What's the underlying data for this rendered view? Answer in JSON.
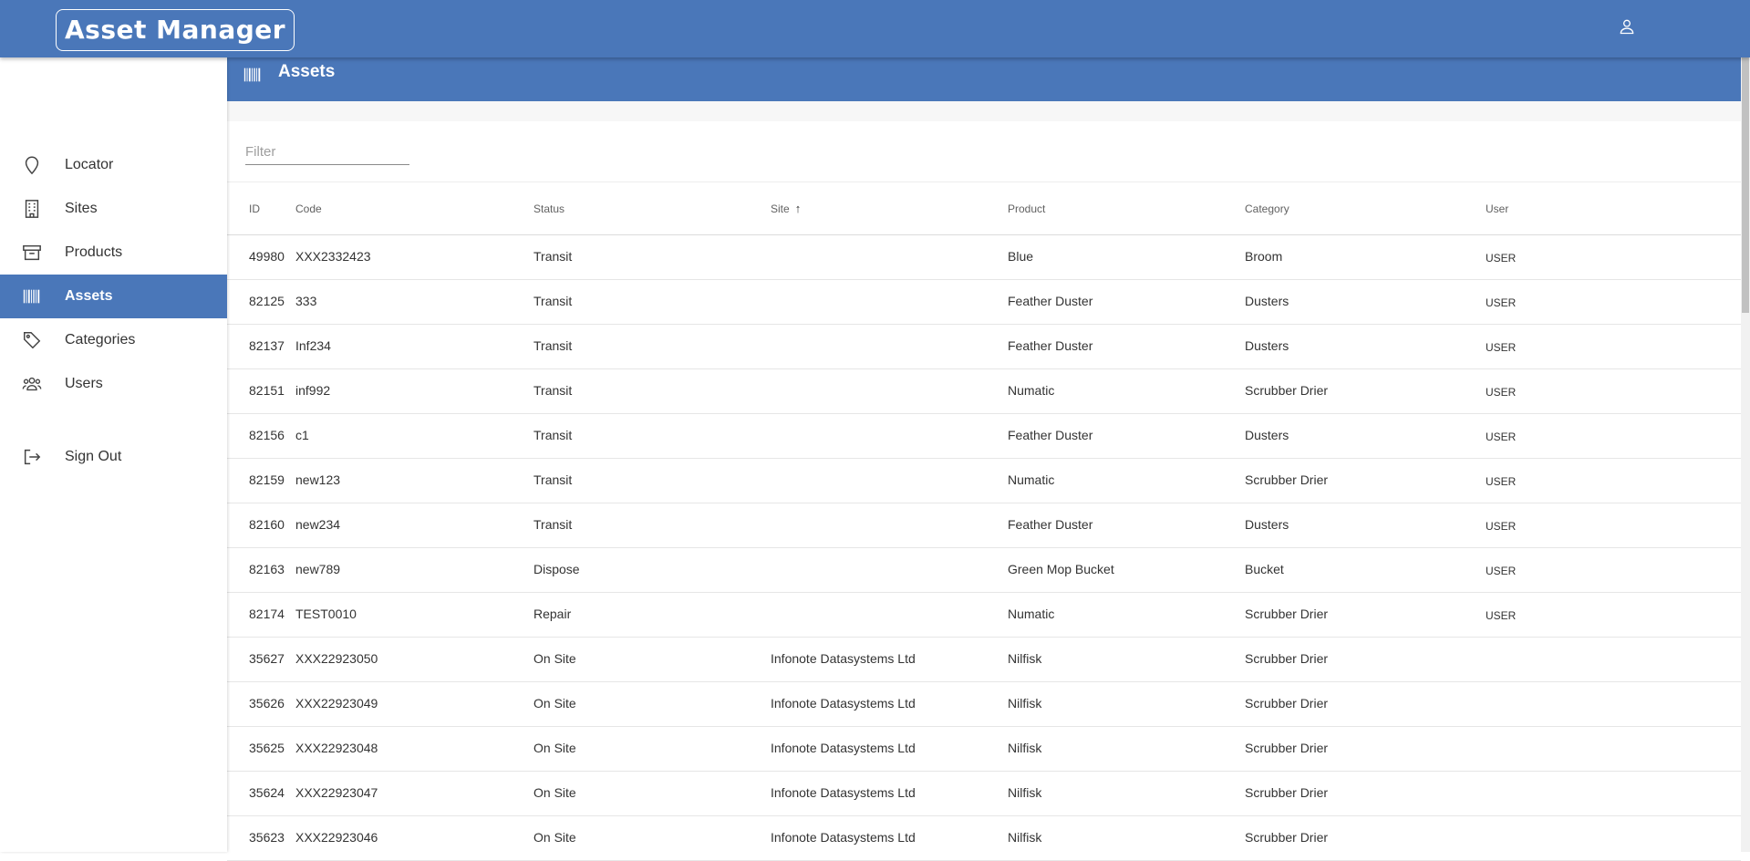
{
  "app": {
    "title": "Asset Manager",
    "icons": {
      "account": "user-icon"
    },
    "colors": {
      "primary": "#4a77b9",
      "text": "#333333"
    }
  },
  "sidebar": {
    "items": [
      {
        "label": "Locator",
        "icon": "map-pin-icon",
        "active": false
      },
      {
        "label": "Sites",
        "icon": "building-icon",
        "active": false
      },
      {
        "label": "Products",
        "icon": "archive-box-icon",
        "active": false
      },
      {
        "label": "Assets",
        "icon": "barcode-icon",
        "active": true
      },
      {
        "label": "Categories",
        "icon": "tag-icon",
        "active": false
      },
      {
        "label": "Users",
        "icon": "users-icon",
        "active": false
      }
    ],
    "sign_out": {
      "label": "Sign Out",
      "icon": "sign-out-icon"
    }
  },
  "page": {
    "title": "Assets",
    "icon": "barcode-icon",
    "filter": {
      "placeholder": "Filter",
      "value": ""
    }
  },
  "table": {
    "columns": {
      "id": "ID",
      "code": "Code",
      "status": "Status",
      "site": "Site",
      "product": "Product",
      "category": "Category",
      "user": "User"
    },
    "sort": {
      "column": "site",
      "direction": "asc",
      "indicator": "↑"
    },
    "rows": [
      {
        "id": "49980",
        "code": "XXX2332423",
        "status": "Transit",
        "site": "",
        "product": "Blue",
        "category": "Broom",
        "user": "USER"
      },
      {
        "id": "82125",
        "code": "333",
        "status": "Transit",
        "site": "",
        "product": "Feather Duster",
        "category": "Dusters",
        "user": "USER"
      },
      {
        "id": "82137",
        "code": "Inf234",
        "status": "Transit",
        "site": "",
        "product": "Feather Duster",
        "category": "Dusters",
        "user": "USER"
      },
      {
        "id": "82151",
        "code": "inf992",
        "status": "Transit",
        "site": "",
        "product": "Numatic",
        "category": "Scrubber Drier",
        "user": "USER"
      },
      {
        "id": "82156",
        "code": "c1",
        "status": "Transit",
        "site": "",
        "product": "Feather Duster",
        "category": "Dusters",
        "user": "USER"
      },
      {
        "id": "82159",
        "code": "new123",
        "status": "Transit",
        "site": "",
        "product": "Numatic",
        "category": "Scrubber Drier",
        "user": "USER"
      },
      {
        "id": "82160",
        "code": "new234",
        "status": "Transit",
        "site": "",
        "product": "Feather Duster",
        "category": "Dusters",
        "user": "USER"
      },
      {
        "id": "82163",
        "code": "new789",
        "status": "Dispose",
        "site": "",
        "product": "Green Mop Bucket",
        "category": "Bucket",
        "user": "USER"
      },
      {
        "id": "82174",
        "code": "TEST0010",
        "status": "Repair",
        "site": "",
        "product": "Numatic",
        "category": "Scrubber Drier",
        "user": "USER"
      },
      {
        "id": "35627",
        "code": "XXX22923050",
        "status": "On Site",
        "site": "Infonote Datasystems Ltd",
        "product": "Nilfisk",
        "category": "Scrubber Drier",
        "user": ""
      },
      {
        "id": "35626",
        "code": "XXX22923049",
        "status": "On Site",
        "site": "Infonote Datasystems Ltd",
        "product": "Nilfisk",
        "category": "Scrubber Drier",
        "user": ""
      },
      {
        "id": "35625",
        "code": "XXX22923048",
        "status": "On Site",
        "site": "Infonote Datasystems Ltd",
        "product": "Nilfisk",
        "category": "Scrubber Drier",
        "user": ""
      },
      {
        "id": "35624",
        "code": "XXX22923047",
        "status": "On Site",
        "site": "Infonote Datasystems Ltd",
        "product": "Nilfisk",
        "category": "Scrubber Drier",
        "user": ""
      },
      {
        "id": "35623",
        "code": "XXX22923046",
        "status": "On Site",
        "site": "Infonote Datasystems Ltd",
        "product": "Nilfisk",
        "category": "Scrubber Drier",
        "user": ""
      }
    ]
  }
}
